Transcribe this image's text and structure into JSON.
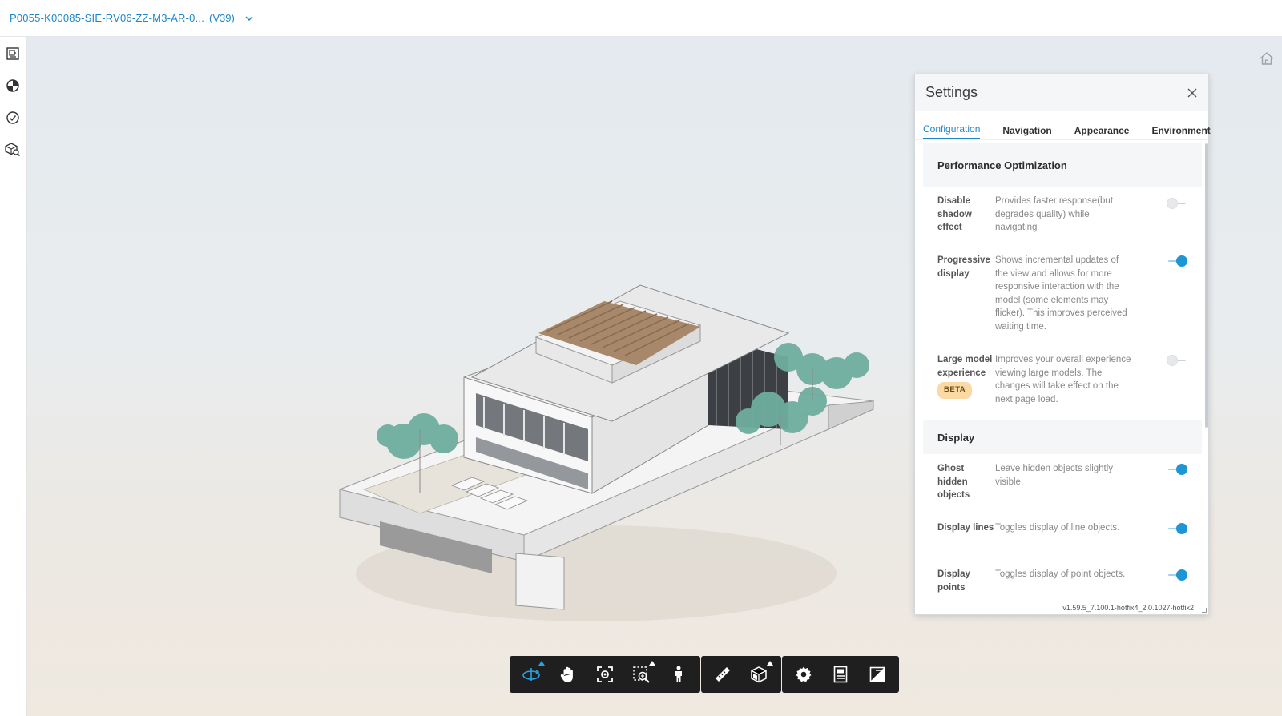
{
  "header": {
    "document_title": "P0055-K00085-SIE-RV06-ZZ-M3-AR-0...",
    "version": "(V39)"
  },
  "left_rail": {
    "items": [
      {
        "icon": "sheets-icon"
      },
      {
        "icon": "model-browser-icon"
      },
      {
        "icon": "issues-check-icon"
      },
      {
        "icon": "model-search-icon"
      }
    ]
  },
  "viewport": {
    "home_icon": "home-icon"
  },
  "settings": {
    "title": "Settings",
    "tabs": [
      "Configuration",
      "Navigation",
      "Appearance",
      "Environment"
    ],
    "active_tab": "Configuration",
    "sections": [
      {
        "title": "Performance Optimization",
        "rows": [
          {
            "label": "Disable shadow effect",
            "description": "Provides faster response(but degrades quality) while navigating",
            "enabled": false
          },
          {
            "label": "Progressive display",
            "description": "Shows incremental updates of the view and allows for more responsive interaction with the model (some elements may flicker). This improves perceived waiting time.",
            "enabled": true
          },
          {
            "label": "Large model experience",
            "badge": "BETA",
            "description": "Improves your overall experience viewing large models. The changes will take effect on the next page load.",
            "enabled": false
          }
        ]
      },
      {
        "title": "Display",
        "rows": [
          {
            "label": "Ghost hidden objects",
            "description": "Leave hidden objects slightly visible.",
            "enabled": true
          },
          {
            "label": "Display lines",
            "description": "Toggles display of line objects.",
            "enabled": true
          },
          {
            "label": "Display points",
            "description": "Toggles display of point objects.",
            "enabled": true
          }
        ]
      }
    ],
    "version_text": "v1.59.5_7.100.1-hotfix4_2.0.1027-hotfix2"
  },
  "toolbar": {
    "groups": [
      [
        "orbit-icon",
        "pan-icon",
        "fit-to-view-icon",
        "zoom-window-icon",
        "first-person-icon"
      ],
      [
        "measure-icon",
        "section-box-icon"
      ],
      [
        "settings-icon",
        "properties-icon",
        "fullscreen-icon"
      ]
    ]
  },
  "colors": {
    "accent": "#1e86c8",
    "toggle_on": "#1e95d4",
    "toolbar_bg": "#1f1f1f",
    "beta_badge": "#fbd9a5"
  }
}
